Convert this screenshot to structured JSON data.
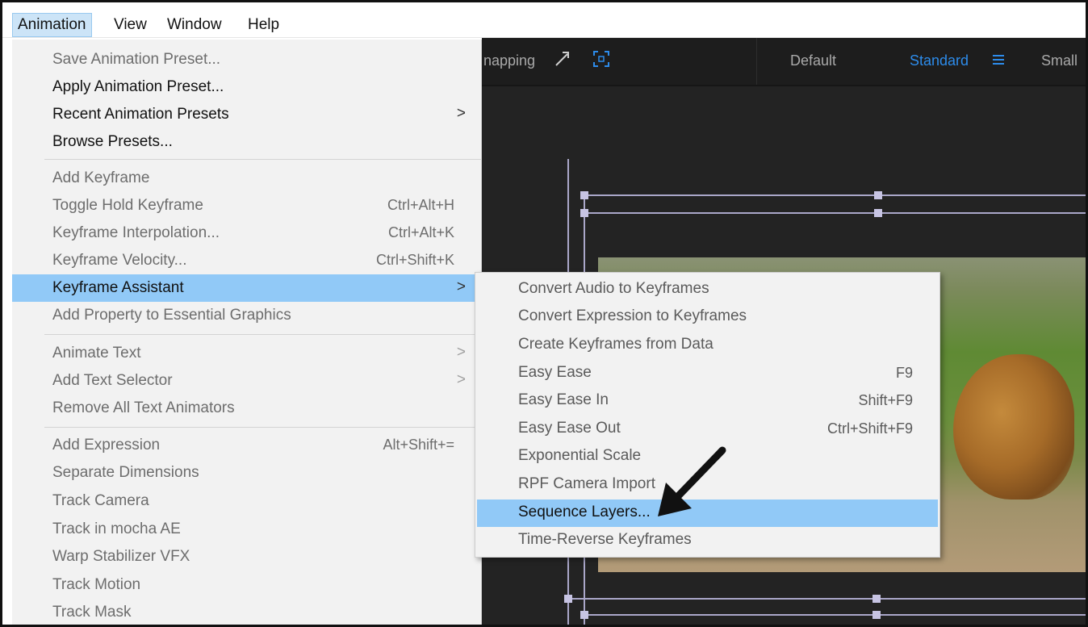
{
  "menubar": {
    "items": [
      {
        "label": "Animation",
        "active": true
      },
      {
        "label": "View"
      },
      {
        "label": "Window"
      },
      {
        "label": "Help"
      }
    ]
  },
  "toolbar": {
    "snapping": "napping",
    "default": "Default",
    "standard": "Standard",
    "small": "Small"
  },
  "animation_menu": {
    "items": [
      {
        "label": "Save Animation Preset...",
        "enabled": false
      },
      {
        "label": "Apply Animation Preset...",
        "enabled": true
      },
      {
        "label": "Recent Animation Presets",
        "enabled": true,
        "submenu": true
      },
      {
        "label": "Browse Presets...",
        "enabled": true
      },
      {
        "label": "Add Keyframe",
        "enabled": false
      },
      {
        "label": "Toggle Hold Keyframe",
        "shortcut": "Ctrl+Alt+H",
        "enabled": false
      },
      {
        "label": "Keyframe Interpolation...",
        "shortcut": "Ctrl+Alt+K",
        "enabled": false
      },
      {
        "label": "Keyframe Velocity...",
        "shortcut": "Ctrl+Shift+K",
        "enabled": false
      },
      {
        "label": "Keyframe Assistant",
        "enabled": true,
        "submenu": true,
        "highlighted": true
      },
      {
        "label": "Add Property to Essential Graphics",
        "enabled": false
      },
      {
        "label": "Animate Text",
        "enabled": false,
        "submenu": true
      },
      {
        "label": "Add Text Selector",
        "enabled": false,
        "submenu": true
      },
      {
        "label": "Remove All Text Animators",
        "enabled": false
      },
      {
        "label": "Add Expression",
        "shortcut": "Alt+Shift+=",
        "enabled": false
      },
      {
        "label": "Separate Dimensions",
        "enabled": false
      },
      {
        "label": "Track Camera",
        "enabled": false
      },
      {
        "label": "Track in mocha AE",
        "enabled": false
      },
      {
        "label": "Warp Stabilizer VFX",
        "enabled": false
      },
      {
        "label": "Track Motion",
        "enabled": false
      },
      {
        "label": "Track Mask",
        "enabled": false
      }
    ]
  },
  "keyframe_assistant_submenu": {
    "items": [
      {
        "label": "Convert Audio to Keyframes"
      },
      {
        "label": "Convert Expression to Keyframes"
      },
      {
        "label": "Create Keyframes from Data"
      },
      {
        "label": "Easy Ease",
        "shortcut": "F9"
      },
      {
        "label": "Easy Ease In",
        "shortcut": "Shift+F9"
      },
      {
        "label": "Easy Ease Out",
        "shortcut": "Ctrl+Shift+F9"
      },
      {
        "label": "Exponential Scale"
      },
      {
        "label": "RPF Camera Import"
      },
      {
        "label": "Sequence Layers...",
        "highlighted": true
      },
      {
        "label": "Time-Reverse Keyframes"
      }
    ]
  },
  "icons": {
    "submenu_arrow": ">",
    "snap_icon": "snapping-icon",
    "grid_icon": "grid-target-icon",
    "menu_icon": "hamburger-icon"
  }
}
